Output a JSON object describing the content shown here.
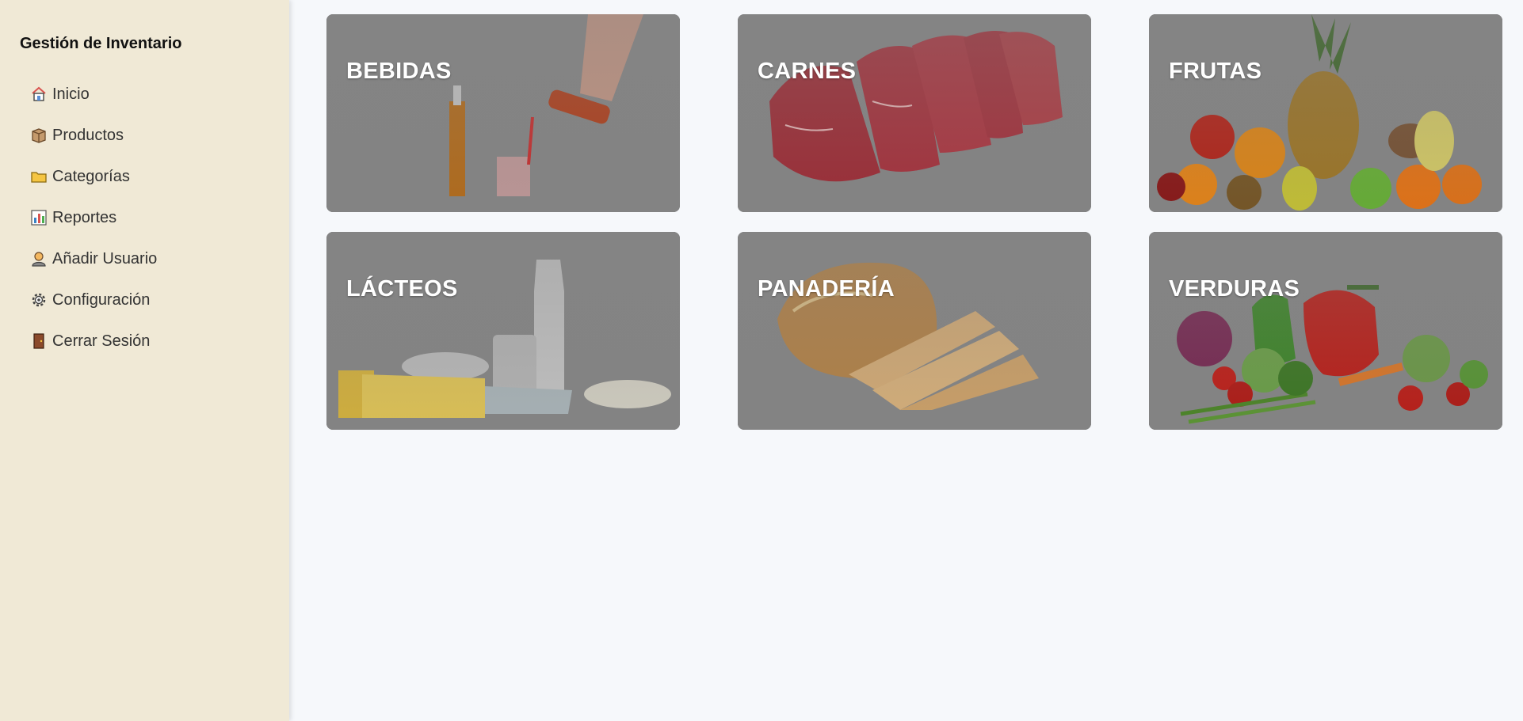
{
  "sidebar": {
    "title": "Gestión de Inventario",
    "items": [
      {
        "label": "Inicio",
        "icon": "house-icon"
      },
      {
        "label": "Productos",
        "icon": "box-icon"
      },
      {
        "label": "Categorías",
        "icon": "folder-icon"
      },
      {
        "label": "Reportes",
        "icon": "bar-chart-icon"
      },
      {
        "label": "Añadir Usuario",
        "icon": "user-icon"
      },
      {
        "label": "Configuración",
        "icon": "gear-icon"
      },
      {
        "label": "Cerrar Sesión",
        "icon": "door-icon"
      }
    ]
  },
  "categories": [
    {
      "label": "BEBIDAS"
    },
    {
      "label": "CARNES"
    },
    {
      "label": "FRUTAS"
    },
    {
      "label": "LÁCTEOS"
    },
    {
      "label": "PANADERÍA"
    },
    {
      "label": "VERDURAS"
    }
  ],
  "colors": {
    "sidebar_bg": "#f0e9d6",
    "page_bg": "#f6f8fb",
    "card_overlay": "#7d7d7d",
    "card_text": "#ffffff"
  }
}
